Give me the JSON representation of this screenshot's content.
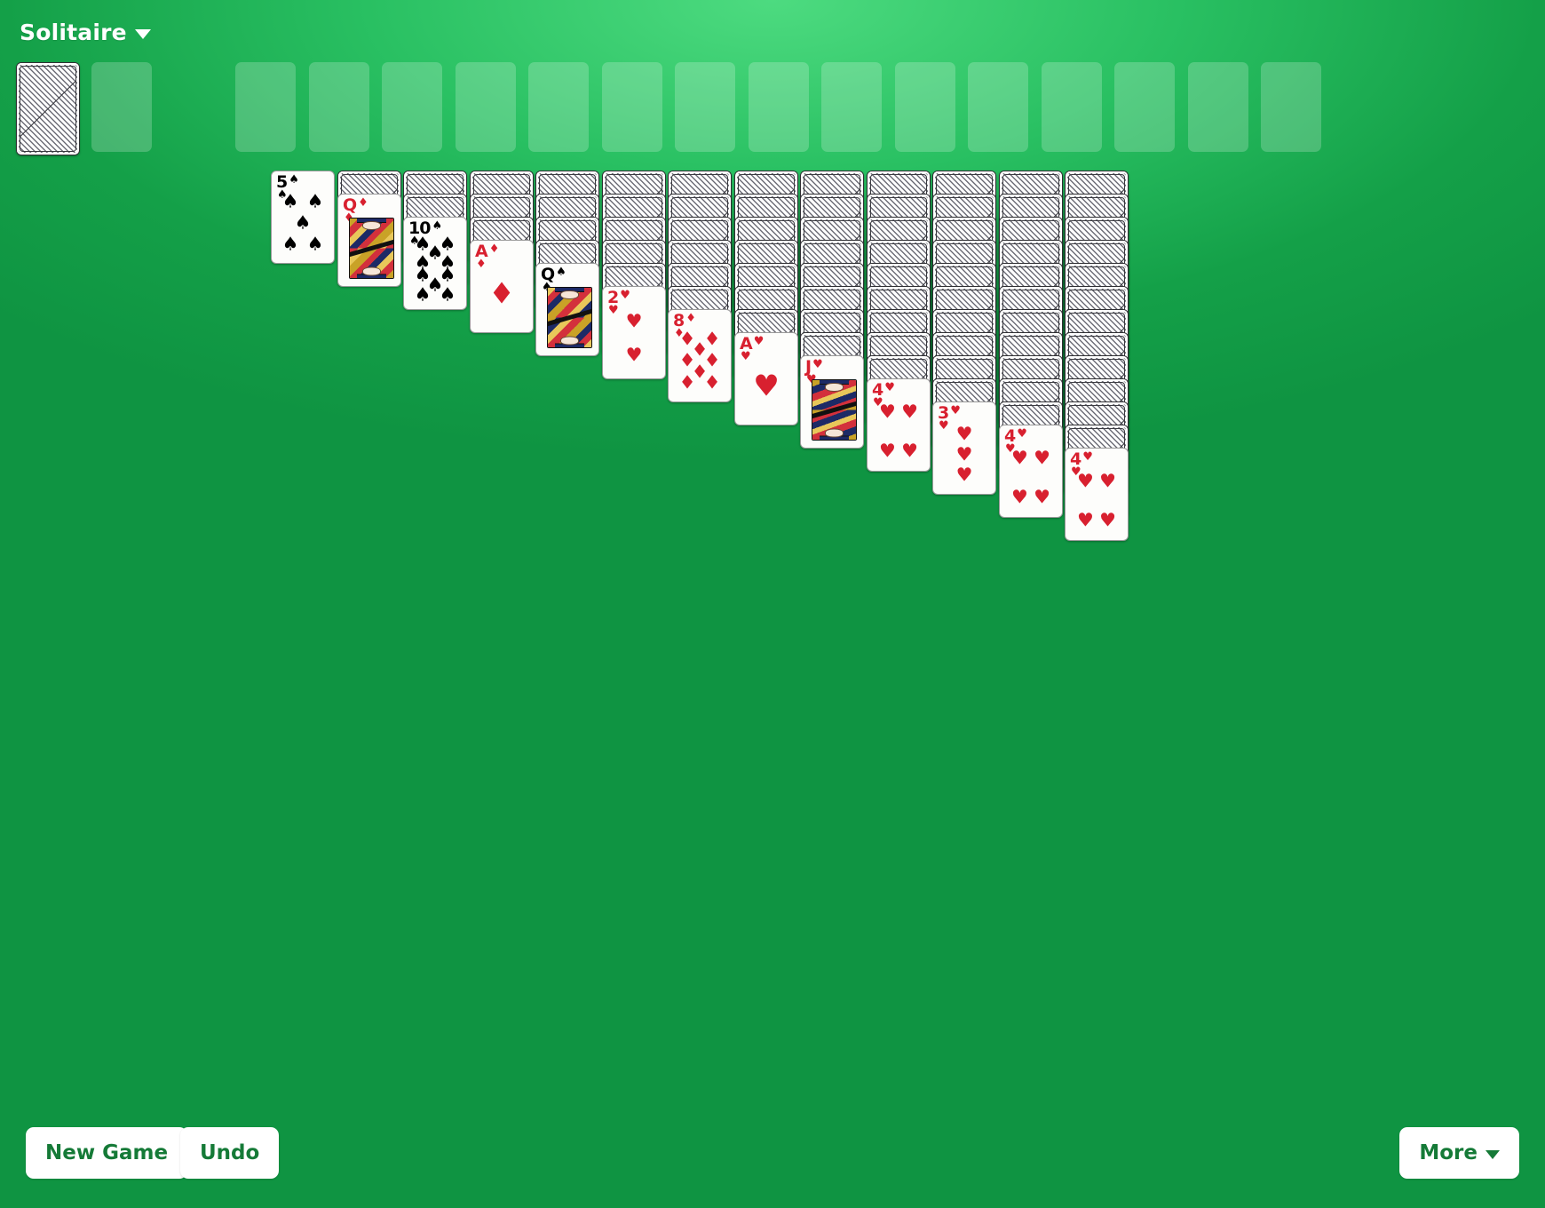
{
  "header": {
    "title": "Solitaire",
    "menu_caret_icon": "chevron-down-icon"
  },
  "colors": {
    "table_green": "#19a34a",
    "table_green_light": "#4ddb80",
    "empty_slot": "rgba(255,255,255,0.21)",
    "card_face": "#fdfdfb",
    "red_suit": "#d8202f",
    "black_suit": "#000000",
    "button_text": "#157a37",
    "button_bg": "#ffffff"
  },
  "top_row": {
    "stock": {
      "type": "card-back",
      "label": "Stock pile"
    },
    "waste_slot": {
      "type": "empty-slot"
    },
    "foundation_slot_count": 15
  },
  "tableau": {
    "column_count": 13,
    "columns": [
      {
        "index": 1,
        "face_down": 0,
        "face_up": {
          "rank": "5",
          "suit": "spades",
          "symbol": "♠",
          "color": "black"
        }
      },
      {
        "index": 2,
        "face_down": 1,
        "face_up": {
          "rank": "Q",
          "suit": "diamonds",
          "symbol": "♦",
          "color": "red",
          "court": true
        }
      },
      {
        "index": 3,
        "face_down": 2,
        "face_up": {
          "rank": "10",
          "suit": "spades",
          "symbol": "♠",
          "color": "black"
        }
      },
      {
        "index": 4,
        "face_down": 3,
        "face_up": {
          "rank": "A",
          "suit": "diamonds",
          "symbol": "♦",
          "color": "red"
        }
      },
      {
        "index": 5,
        "face_down": 4,
        "face_up": {
          "rank": "Q",
          "suit": "spades",
          "symbol": "♠",
          "color": "black",
          "court": true
        }
      },
      {
        "index": 6,
        "face_down": 5,
        "face_up": {
          "rank": "2",
          "suit": "hearts",
          "symbol": "♥",
          "color": "red"
        }
      },
      {
        "index": 7,
        "face_down": 6,
        "face_up": {
          "rank": "8",
          "suit": "diamonds",
          "symbol": "♦",
          "color": "red"
        }
      },
      {
        "index": 8,
        "face_down": 7,
        "face_up": {
          "rank": "A",
          "suit": "hearts",
          "symbol": "♥",
          "color": "red"
        }
      },
      {
        "index": 9,
        "face_down": 8,
        "face_up": {
          "rank": "J",
          "suit": "hearts",
          "symbol": "♥",
          "color": "red",
          "court": true
        }
      },
      {
        "index": 10,
        "face_down": 9,
        "face_up": {
          "rank": "4",
          "suit": "hearts",
          "symbol": "♥",
          "color": "red"
        }
      },
      {
        "index": 11,
        "face_down": 10,
        "face_up": {
          "rank": "3",
          "suit": "hearts",
          "symbol": "♥",
          "color": "red"
        }
      },
      {
        "index": 12,
        "face_down": 11,
        "face_up": {
          "rank": "4",
          "suit": "hearts",
          "symbol": "♥",
          "color": "red"
        }
      },
      {
        "index": 13,
        "face_down": 12,
        "face_up": {
          "rank": "4",
          "suit": "hearts",
          "symbol": "♥",
          "color": "red"
        }
      }
    ]
  },
  "bottom_bar": {
    "new_game_label": "New Game",
    "undo_label": "Undo",
    "more_label": "More",
    "more_caret_icon": "chevron-down-icon"
  }
}
